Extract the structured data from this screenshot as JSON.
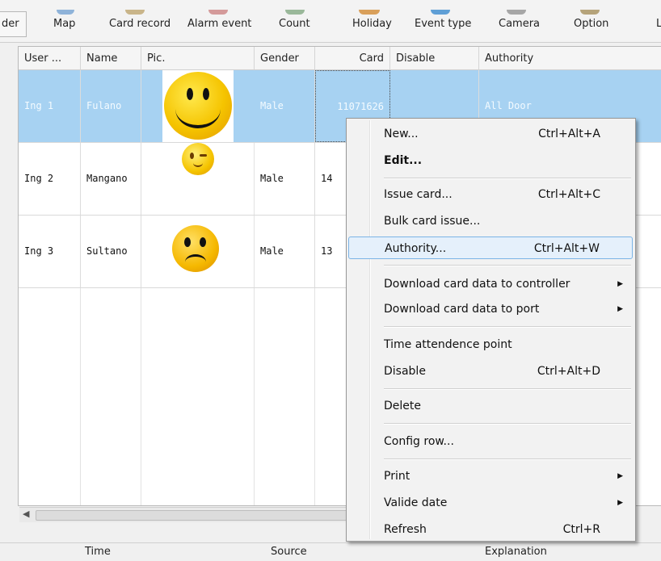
{
  "toolbar": {
    "items": [
      "der",
      "Map",
      "Card record",
      "Alarm event",
      "Count",
      "Holiday",
      "Event type",
      "Camera",
      "Option",
      "L"
    ]
  },
  "grid": {
    "columns": [
      "User ...",
      "Name",
      "Pic.",
      "Gender",
      "Card",
      "Disable",
      "Authority"
    ],
    "rows": [
      {
        "user": "Ing 1",
        "name": "Fulano",
        "gender": "Male",
        "card": "11071626",
        "disable": "",
        "authority": "All Door"
      },
      {
        "user": "Ing 2",
        "name": "Mangano",
        "gender": "Male",
        "card": "14",
        "disable": "",
        "authority": ""
      },
      {
        "user": "Ing 3",
        "name": "Sultano",
        "gender": "Male",
        "card": "13",
        "disable": "",
        "authority": ""
      }
    ]
  },
  "bottom_headers": [
    "Time",
    "Source",
    "Explanation"
  ],
  "context_menu": {
    "items": [
      {
        "label": "New...",
        "shortcut": "Ctrl+Alt+A"
      },
      {
        "label": "Edit...",
        "shortcut": ""
      },
      {
        "label": "Issue card...",
        "shortcut": "Ctrl+Alt+C"
      },
      {
        "label": "Bulk card issue...",
        "shortcut": ""
      },
      {
        "label": "Authority...",
        "shortcut": "Ctrl+Alt+W"
      },
      {
        "label": "Download card data to controller",
        "shortcut": ""
      },
      {
        "label": "Download card data to port",
        "shortcut": ""
      },
      {
        "label": "Time attendence point",
        "shortcut": ""
      },
      {
        "label": "Disable",
        "shortcut": "Ctrl+Alt+D"
      },
      {
        "label": "Delete",
        "shortcut": ""
      },
      {
        "label": "Config row...",
        "shortcut": ""
      },
      {
        "label": "Print",
        "shortcut": ""
      },
      {
        "label": "Valide date",
        "shortcut": ""
      },
      {
        "label": "Refresh",
        "shortcut": "Ctrl+R"
      }
    ]
  },
  "colors": {
    "selected_row": "#a7d2f2",
    "menu_highlight": "#e5f0fb",
    "face_yellow": "#f5c400"
  }
}
